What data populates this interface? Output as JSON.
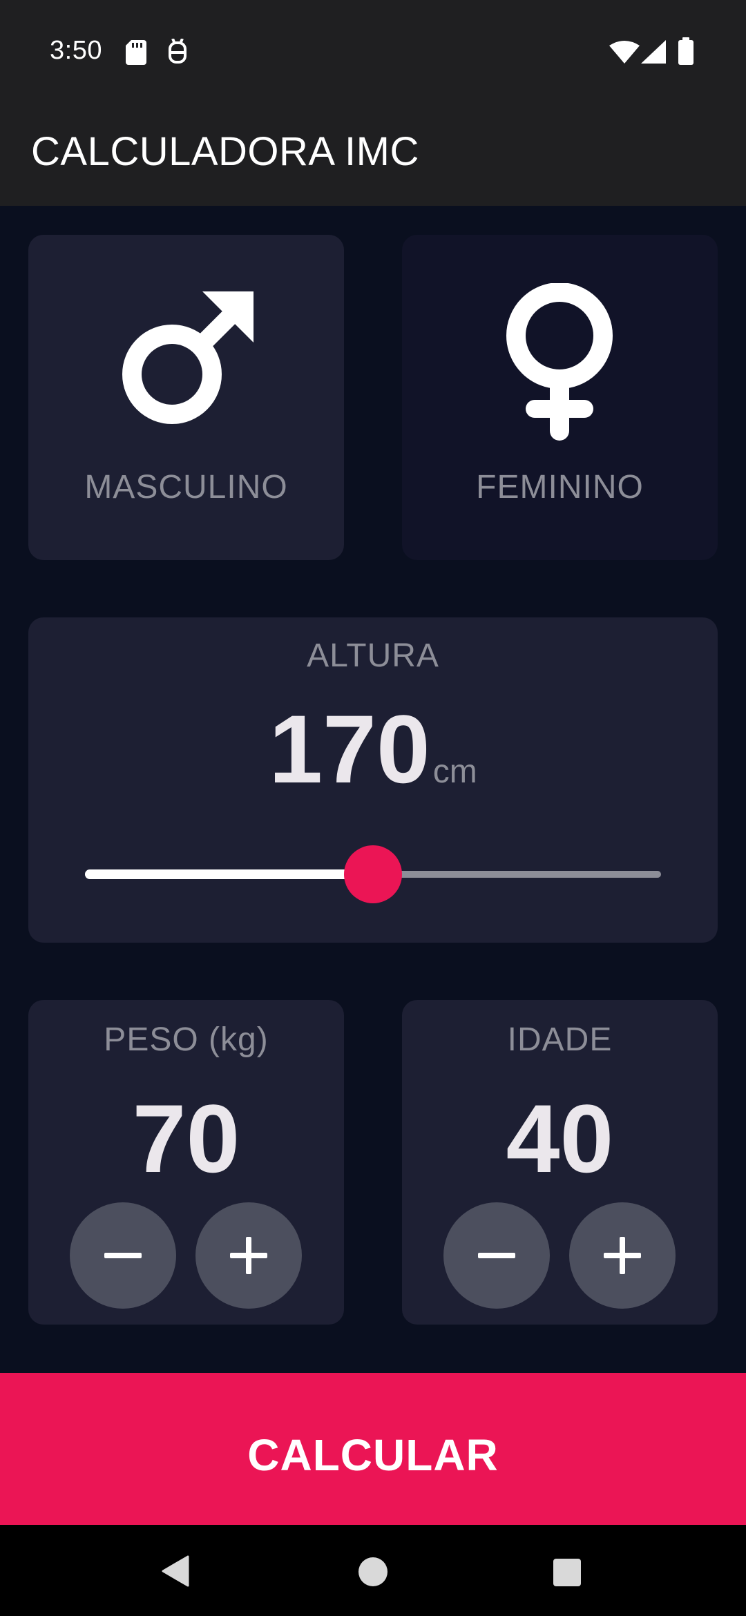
{
  "status_bar": {
    "time": "3:50",
    "icons": [
      "sd-card-icon",
      "notification-icon",
      "wifi-icon",
      "signal-icon",
      "battery-icon"
    ]
  },
  "app_bar": {
    "title": "CALCULADORA IMC"
  },
  "gender": {
    "male": {
      "label": "MASCULINO",
      "icon": "male-icon",
      "selected": true
    },
    "female": {
      "label": "FEMININO",
      "icon": "female-icon",
      "selected": false
    }
  },
  "height": {
    "label": "ALTURA",
    "value": "170",
    "unit": "cm",
    "slider_fraction": 0.5
  },
  "weight": {
    "label": "PESO (kg)",
    "value": "70"
  },
  "age": {
    "label": "IDADE",
    "value": "40"
  },
  "calculate": {
    "label": "CALCULAR"
  },
  "nav_bar": {
    "icons": [
      "back-icon",
      "home-icon",
      "recents-icon"
    ]
  },
  "colors": {
    "background": "#0a0f1f",
    "card_active": "#1d1f33",
    "card_inactive": "#111328",
    "accent": "#eb1555",
    "label": "#8d8e98",
    "number": "#ebe7ec",
    "round_button": "#4c4f5e"
  }
}
